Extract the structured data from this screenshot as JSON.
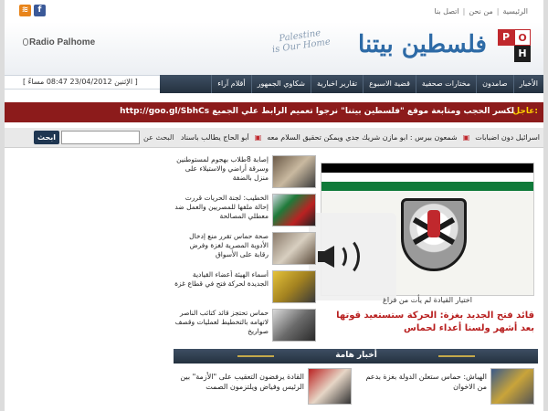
{
  "topbar": {
    "links": [
      "الرئيسية",
      "من نحن",
      "اتصل بنا"
    ],
    "separator": "|",
    "social": [
      {
        "name": "facebook-icon",
        "glyph": "f"
      },
      {
        "name": "rss-icon",
        "glyph": "≋"
      }
    ]
  },
  "header": {
    "brand_arabic": "فلسطين بيتنا",
    "brand_english_line1": "Palestine",
    "brand_english_line2": "is Our Home",
    "radio_logo": "Radio Palhome",
    "ph_logo": {
      "p": "P",
      "o": "O",
      "h": "H"
    }
  },
  "datebar": {
    "text": "[ الإثنين 23/04/2012      08:47 مساءً ]"
  },
  "nav": {
    "items": [
      "الأخبار",
      "صامدون",
      "مختارات صحفية",
      "قضية الاسبوع",
      "تقارير اخبارية",
      "شكاوي الجمهور",
      "أقلام آراء"
    ]
  },
  "breaking": {
    "label": "عاجل:",
    "text": "لكسر الحجب ومتابعة موقع \"فلسطين بيتنا\" نرجوا تعميم الرابط علي الجميع http://goo.gl/SbhCs"
  },
  "ticker": {
    "items": [
      "اسرائيل دون اضبابات",
      "شمعون بيرس : ابو مازن شريك جدي ويمكن تحقيق السلام معه",
      "أبو الحاج يطالب باسناد"
    ],
    "search_label": "البحث عن",
    "search_button": "ابحث",
    "search_value": ""
  },
  "lead": {
    "caption": "اختيار القيادة لم يأت من فراغ",
    "title": "قائد فتح الجديد بغزة: الحركة ستستعيد قوتها بعد أشهر ولسنا أعداء لحماس"
  },
  "news": [
    {
      "text": "إصابة 8طلاب بهجوم لمستوطنين وسرقة أراضي والاستيلاء على منزل بالضفة"
    },
    {
      "text": "الخطيب: لجنة الحريات قررت إحالة ملفها للمصريين والعمل ضد معطلي المصالحة"
    },
    {
      "text": "صحة حماس تقرر منع إدخال الأدوية المصرية لغزة وفرض رقابة على الأسواق"
    },
    {
      "text": "أسماء الهيئة أعضاء القيادية الجديدة لحركة فتح في قطاع غزة"
    },
    {
      "text": "حماس تحتجز قائد كتائب الناصر لاتهامه بالتخطيط لعمليات وقصف صواريخ"
    }
  ],
  "section": {
    "title": "أخبار هامة"
  },
  "bottom_news": [
    {
      "text": "الهباش: حماس ستعلن الدولة بغزة بدعم من الاخوان"
    },
    {
      "text": "القادة يرفضون التعقيب على \"الأزمة\" بين الرئيس وفياض ويلتزمون الصمت"
    }
  ],
  "colors": {
    "nav": "#24313f",
    "breaking": "#8c1b1b",
    "accent": "#b81f1f",
    "brand": "#2d6aa6"
  }
}
